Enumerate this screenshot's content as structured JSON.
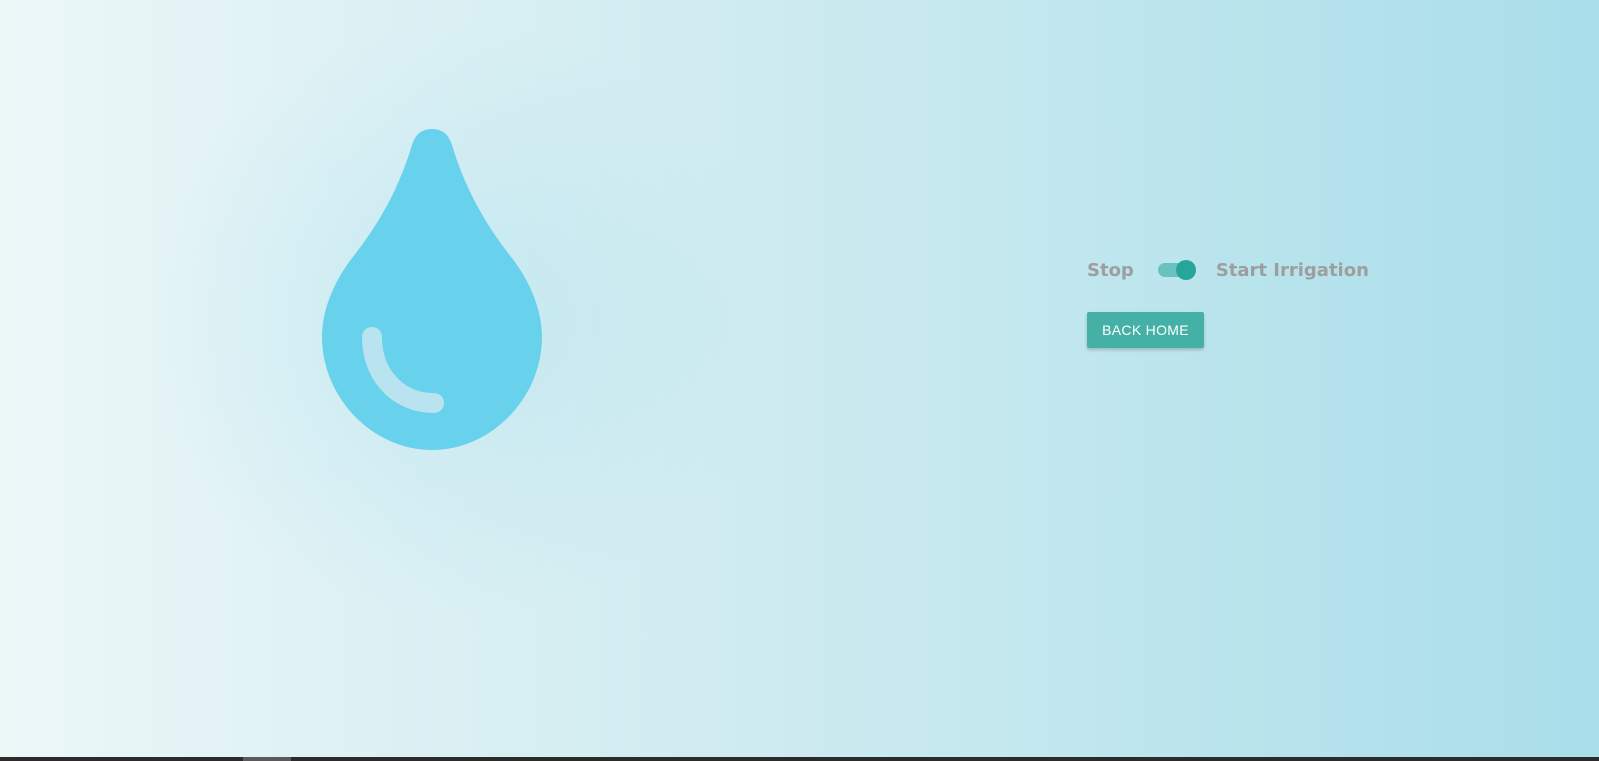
{
  "illustration": {
    "icon": "water-drop-icon",
    "color": "#68d1ec",
    "highlight_color": "#b9e3ef"
  },
  "irrigation": {
    "off_label": "Stop",
    "on_label": "Start Irrigation",
    "enabled": true,
    "accent_color": "#26a69a"
  },
  "navigation": {
    "back_label": "BACK HOME"
  }
}
